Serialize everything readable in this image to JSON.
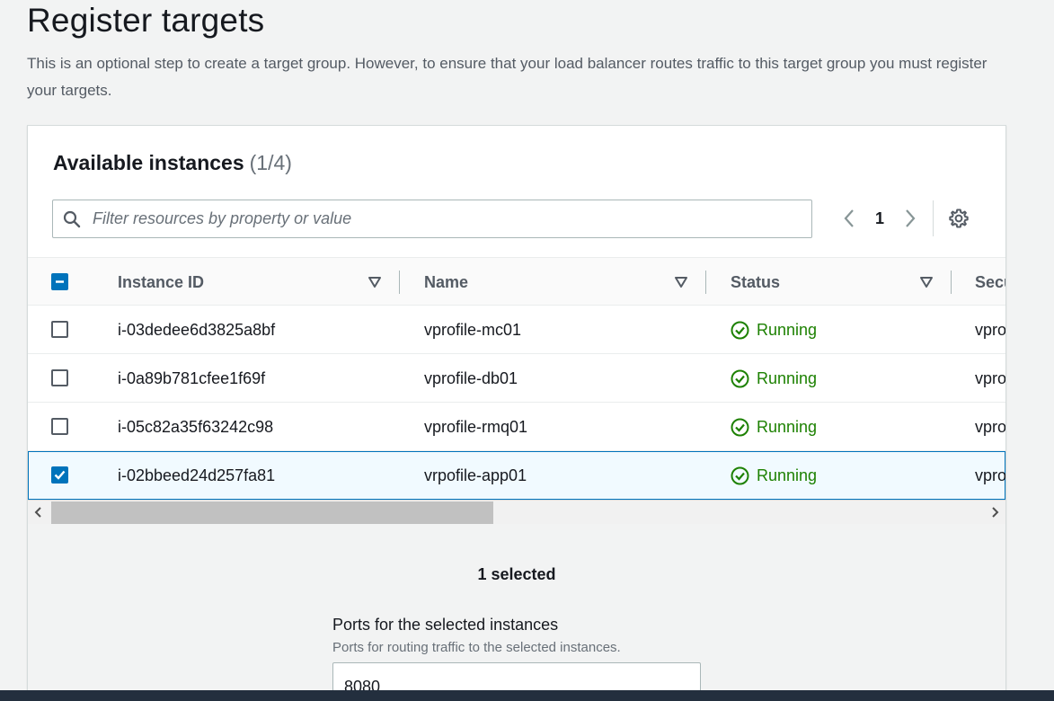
{
  "page": {
    "title": "Register targets",
    "description": "This is an optional step to create a target group. However, to ensure that your load balancer routes traffic to this target group you must register your targets."
  },
  "instances_panel": {
    "heading": "Available instances",
    "count": "(1/4)",
    "filter_placeholder": "Filter resources by property or value",
    "current_page": "1",
    "columns": [
      "Instance ID",
      "Name",
      "Status",
      "Secu"
    ],
    "rows": [
      {
        "instance_id": "i-03dedee6d3825a8bf",
        "name": "vprofile-mc01",
        "status": "Running",
        "security": "vpro",
        "selected": false
      },
      {
        "instance_id": "i-0a89b781cfee1f69f",
        "name": "vprofile-db01",
        "status": "Running",
        "security": "vpro",
        "selected": false
      },
      {
        "instance_id": "i-05c82a35f63242c98",
        "name": "vprofile-rmq01",
        "status": "Running",
        "security": "vpro",
        "selected": false
      },
      {
        "instance_id": "i-02bbeed24d257fa81",
        "name": "vrpofile-app01",
        "status": "Running",
        "security": "vpro",
        "selected": true
      }
    ],
    "selected_summary": "1 selected",
    "ports_label": "Ports for the selected instances",
    "ports_help": "Ports for routing traffic to the selected instances.",
    "ports_value": "8080"
  },
  "colors": {
    "accent": "#0073bb",
    "success": "#1d8102",
    "text": "#16191f",
    "muted": "#545b64"
  },
  "icons": [
    "search-icon",
    "chevron-left-icon",
    "chevron-right-icon",
    "settings-gear-icon",
    "sort-icon",
    "status-check-icon",
    "checkbox-icon",
    "scroll-left-icon",
    "scroll-right-icon"
  ]
}
